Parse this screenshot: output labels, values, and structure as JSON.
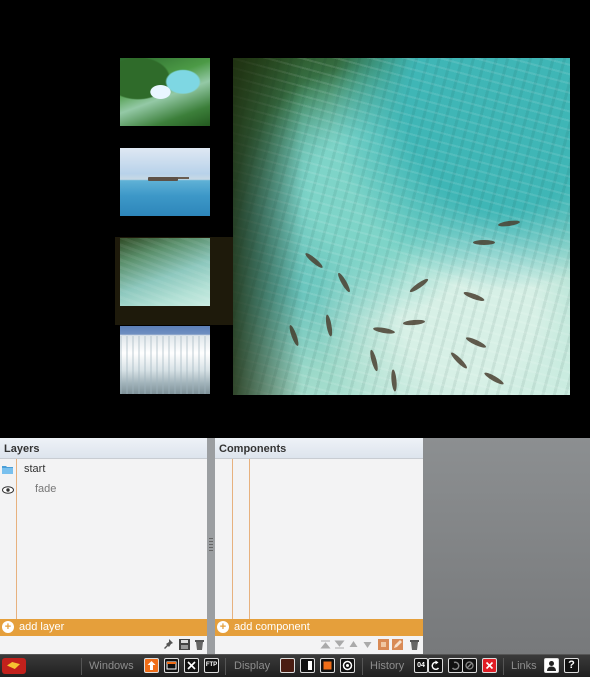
{
  "layers": {
    "title": "Layers",
    "items": [
      {
        "name": "start",
        "icon": "folder-icon"
      },
      {
        "name": "fade",
        "icon": "eye-icon"
      }
    ],
    "add_label": "add layer"
  },
  "components": {
    "title": "Components",
    "add_label": "add component"
  },
  "toolbar": {
    "windows_label": "Windows",
    "display_label": "Display",
    "history_label": "History",
    "history_count": "04",
    "ftp_label": "FTP",
    "links_label": "Links",
    "help_label": "?"
  },
  "colors": {
    "accent": "#e59f3b",
    "toolbar_orange": "#f06d18",
    "toolbar_red": "#e01d25"
  }
}
